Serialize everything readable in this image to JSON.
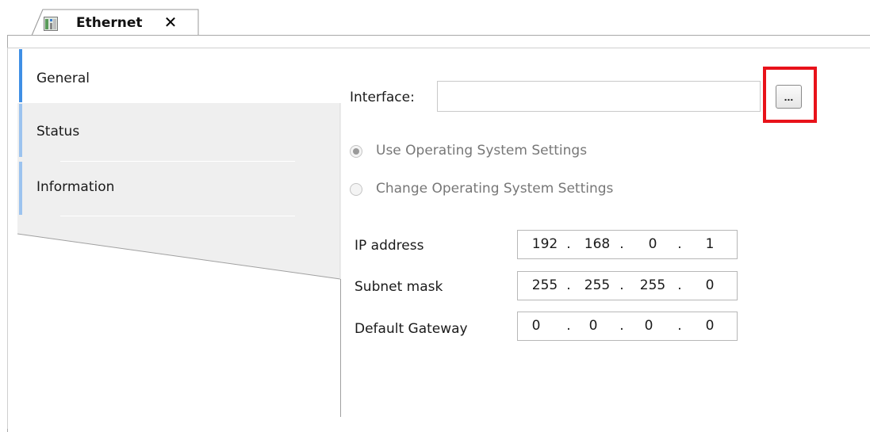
{
  "tab": {
    "title": "Ethernet",
    "close_glyph": "✕",
    "icon": "device-icon"
  },
  "nav": {
    "items": [
      {
        "label": "General",
        "active": true
      },
      {
        "label": "Status",
        "active": false
      },
      {
        "label": "Information",
        "active": false
      }
    ]
  },
  "interface": {
    "label": "Interface:",
    "value": "",
    "browse_label": "..."
  },
  "os_settings": {
    "use_label": "Use Operating System Settings",
    "change_label": "Change Operating System Settings",
    "selected": "use"
  },
  "ip_address": {
    "label": "IP address",
    "octets": [
      "192",
      "168",
      "0",
      "1"
    ]
  },
  "subnet_mask": {
    "label": "Subnet mask",
    "octets": [
      "255",
      "255",
      "255",
      "0"
    ]
  },
  "default_gateway": {
    "label": "Default Gateway",
    "octets": [
      "0",
      "0",
      "0",
      "0"
    ]
  },
  "colors": {
    "highlight": "#e8121a",
    "active_nav_bar": "#3f8fe5",
    "nav_bar": "#9cc3ef",
    "panel_bg": "#efefef"
  }
}
